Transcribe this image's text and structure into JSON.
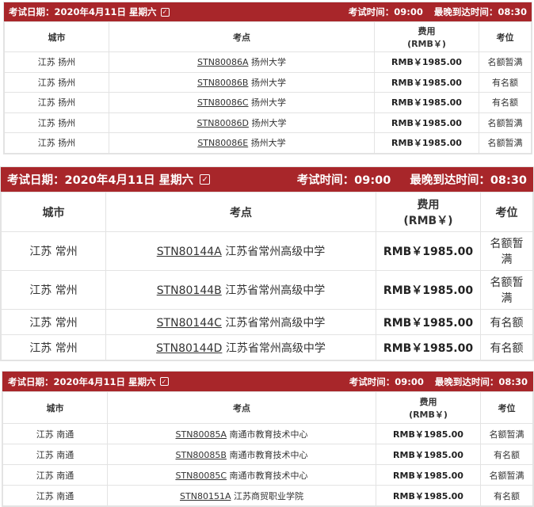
{
  "sections": [
    {
      "header": {
        "date_text": "考试日期：2020年4月11日 星期六",
        "exam_time": "考试时间：09:00",
        "latest_arrival": "最晚到达时间：08:30"
      },
      "columns": {
        "city": "城市",
        "venue": "考点",
        "fee_line1": "费用",
        "fee_line2": "(RMB￥)",
        "status": "考位"
      },
      "rows": [
        {
          "city": "江苏 扬州",
          "code": "STN80086A",
          "venue": "扬州大学",
          "fee": "RMB￥1985.00",
          "status": "名额暂满"
        },
        {
          "city": "江苏 扬州",
          "code": "STN80086B",
          "venue": "扬州大学",
          "fee": "RMB￥1985.00",
          "status": "有名额"
        },
        {
          "city": "江苏 扬州",
          "code": "STN80086C",
          "venue": "扬州大学",
          "fee": "RMB￥1985.00",
          "status": "有名额"
        },
        {
          "city": "江苏 扬州",
          "code": "STN80086D",
          "venue": "扬州大学",
          "fee": "RMB￥1985.00",
          "status": "名额暂满"
        },
        {
          "city": "江苏 扬州",
          "code": "STN80086E",
          "venue": "扬州大学",
          "fee": "RMB￥1985.00",
          "status": "名额暂满"
        }
      ]
    },
    {
      "header": {
        "date_text": "考试日期：2020年4月11日 星期六",
        "exam_time": "考试时间：09:00",
        "latest_arrival": "最晚到达时间：08:30"
      },
      "columns": {
        "city": "城市",
        "venue": "考点",
        "fee_line1": "费用",
        "fee_line2": "(RMB￥)",
        "status": "考位"
      },
      "rows": [
        {
          "city": "江苏 常州",
          "code": "STN80144A",
          "venue": "江苏省常州高级中学",
          "fee": "RMB￥1985.00",
          "status_line1": "名额暂",
          "status_line2": "满"
        },
        {
          "city": "江苏 常州",
          "code": "STN80144B",
          "venue": "江苏省常州高级中学",
          "fee": "RMB￥1985.00",
          "status_line1": "名额暂",
          "status_line2": "满"
        },
        {
          "city": "江苏 常州",
          "code": "STN80144C",
          "venue": "江苏省常州高级中学",
          "fee": "RMB￥1985.00",
          "status_line1": "有名额",
          "status_line2": ""
        },
        {
          "city": "江苏 常州",
          "code": "STN80144D",
          "venue": "江苏省常州高级中学",
          "fee": "RMB￥1985.00",
          "status_line1": "有名额",
          "status_line2": ""
        }
      ]
    },
    {
      "header": {
        "date_text": "考试日期：2020年4月11日 星期六",
        "exam_time": "考试时间：09:00",
        "latest_arrival": "最晚到达时间：08:30"
      },
      "columns": {
        "city": "城市",
        "venue": "考点",
        "fee_line1": "费用",
        "fee_line2": "(RMB￥)",
        "status": "考位"
      },
      "rows": [
        {
          "city": "江苏 南通",
          "code": "STN80085A",
          "venue": "南通市教育技术中心",
          "fee": "RMB￥1985.00",
          "status": "名额暂满"
        },
        {
          "city": "江苏 南通",
          "code": "STN80085B",
          "venue": "南通市教育技术中心",
          "fee": "RMB￥1985.00",
          "status": "有名额"
        },
        {
          "city": "江苏 南通",
          "code": "STN80085C",
          "venue": "南通市教育技术中心",
          "fee": "RMB￥1985.00",
          "status": "名额暂满"
        },
        {
          "city": "江苏 南通",
          "code": "STN80151A",
          "venue": "江苏商贸职业学院",
          "fee": "RMB￥1985.00",
          "status": "有名额"
        }
      ]
    }
  ]
}
